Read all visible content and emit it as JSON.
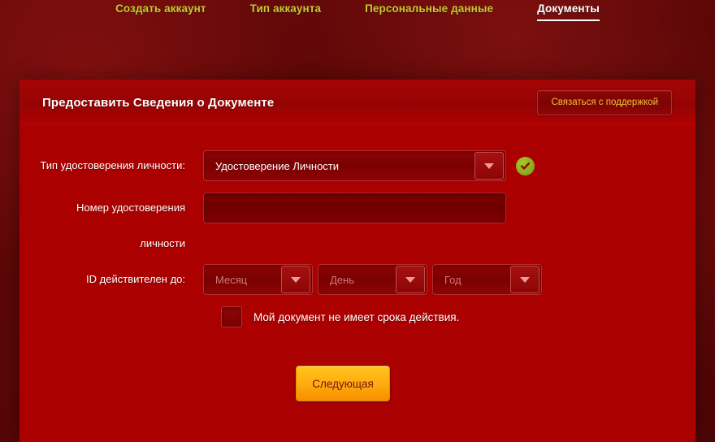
{
  "nav": {
    "tabs": [
      {
        "label": "Создать аккаунт",
        "active": false
      },
      {
        "label": "Тип аккаунта",
        "active": false
      },
      {
        "label": "Персональные данные",
        "active": false
      },
      {
        "label": "Документы",
        "active": true
      }
    ]
  },
  "card": {
    "title": "Предоставить Сведения о Документе",
    "support_button": "Связаться с поддержкой"
  },
  "form": {
    "id_type": {
      "label": "Тип удостоверения личности:",
      "value": "Удостоверение Личности",
      "valid_icon": "check-circle-icon"
    },
    "id_number": {
      "label_line1": "Номер удостоверения",
      "label_line2": "личности",
      "value": "",
      "placeholder": ""
    },
    "expiry": {
      "label": "ID действителен до:",
      "month_placeholder": "Месяц",
      "day_placeholder": "День",
      "year_placeholder": "Год"
    },
    "no_expiry": {
      "label": "Мой документ не имеет срока действия.",
      "checked": false
    },
    "submit_label": "Следующая"
  },
  "colors": {
    "page_background": "#5a0707",
    "card_background": "#ab0000",
    "card_header": "#9a0404",
    "nav_inactive": "#c3cc2e",
    "nav_active": "#ffffff",
    "support_text": "#f0c33c",
    "submit_background": "#fdb110",
    "submit_text": "#7c1111",
    "valid_badge": "#8aa818",
    "caret": "#f09b9b"
  },
  "icons": {
    "caret": "chevron-down-icon",
    "check": "check-icon"
  }
}
